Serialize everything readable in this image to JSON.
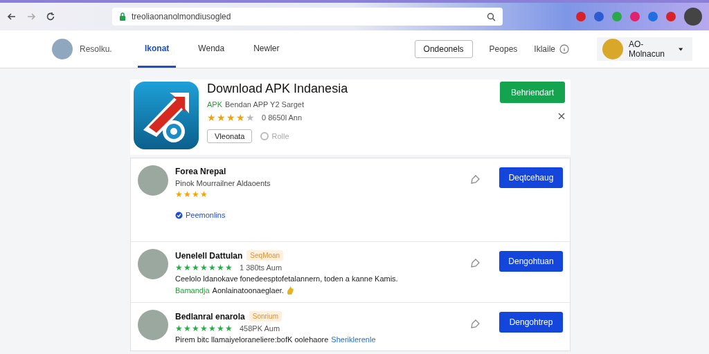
{
  "browser": {
    "address": "treoliaonanolmondiusogled"
  },
  "nav": {
    "brand": "Resolku.",
    "tabs": [
      {
        "label": "Ikonat",
        "selected": true
      },
      {
        "label": "Wenda",
        "selected": false
      },
      {
        "label": "Newler",
        "selected": false
      }
    ],
    "button": "Ondeonels",
    "links": [
      "Peopes",
      "Iklaile"
    ],
    "user": "AO-Molnacun"
  },
  "app": {
    "title": "Download APK Indanesia",
    "tag": "APK",
    "subtitle": "Bendan APP Y2 Sarget",
    "stars": 4,
    "rating_count": "0 8650l Ann",
    "secondary_button": "Vleonata",
    "extra": "Rolle",
    "install_button": "Behriendart"
  },
  "reviews": [
    {
      "name": "Forea Nrepal",
      "color": "#f2a20c",
      "detail": "Pinok Mourrailner Aldaoents",
      "stars": 4,
      "link": "Peemonlins",
      "button": "Deqtcehaug"
    },
    {
      "name": "Uenelell Dattulan",
      "color": "#2aa84a",
      "badge": "SeqMoan",
      "stars": 7,
      "reading": "1 380ts Aum",
      "text": "Ceelolo ldanokave fonedeesptofetalannern, toden a kanne Kamis.",
      "tag": "Bamandja",
      "note": "Aonlainatoonaeglaer.",
      "button": "Dengohtuan"
    },
    {
      "name": "Bedlanral enarola",
      "color": "#2aa84a",
      "badge": "Sonrium",
      "stars": 7,
      "reading": "458PK Aum",
      "text": "Pirem bitc llamaiyeloraneliere:bofK oolehaore",
      "text_link": "Sheriklerenle",
      "button": "Dengohtrep"
    }
  ]
}
